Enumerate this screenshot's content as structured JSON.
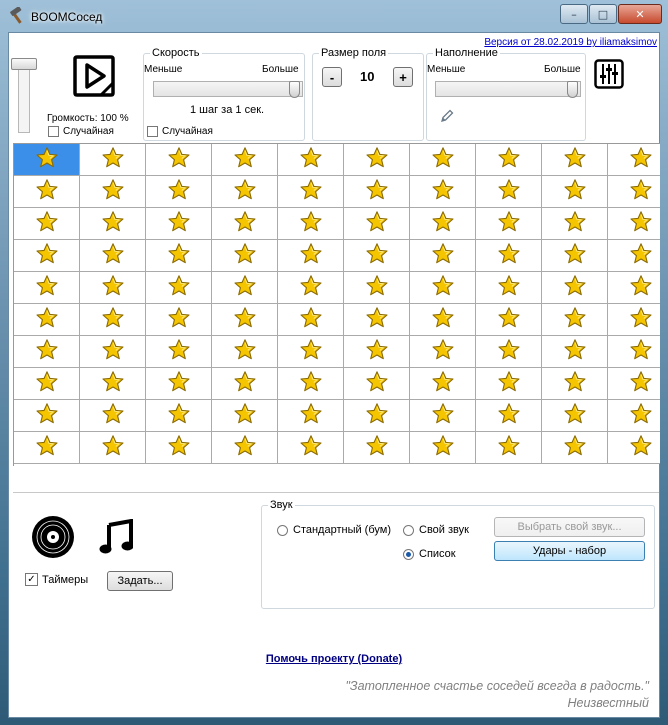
{
  "window": {
    "title": "BOOMСосед",
    "icon": "hammer-icon",
    "buttons": {
      "minimize": "–",
      "maximize": "□",
      "close": "✕"
    }
  },
  "version_link": "Версия от 28.02.2019 by iliamaksimov",
  "volume": {
    "label": "Громкость: 100 %",
    "value": 100,
    "random_label": "Случайная"
  },
  "speed": {
    "legend": "Скорость",
    "less": "Меньше",
    "more": "Больше",
    "step_text": "1 шаг за 1 сек.",
    "random_label": "Случайная"
  },
  "field_size": {
    "legend": "Размер поля",
    "minus": "-",
    "value": "10",
    "plus": "+"
  },
  "fill": {
    "legend": "Наполнение",
    "less": "Меньше",
    "more": "Больше",
    "edit_icon": "pencil-icon"
  },
  "mixer_icon": "equalizer-icon",
  "grid": {
    "rows": 10,
    "cols": 10,
    "cell_icon": "star-icon",
    "selected_cell": [
      0,
      0
    ],
    "selected_color": "#3b8fe8"
  },
  "bottom": {
    "vinyl_icon": "vinyl-record-icon",
    "music_icon": "music-note-icon",
    "timers_label": "Таймеры",
    "timers_checked": true,
    "set_button": "Задать..."
  },
  "sound": {
    "legend": "Звук",
    "standard_label": "Стандартный (бум)",
    "own_label": "Свой звук",
    "list_label": "Список",
    "selected": "list",
    "choose_button": "Выбрать свой звук...",
    "hits_button": "Удары - набор"
  },
  "donate_link": "Помочь проекту (Donate)",
  "quote": "\"Затопленное счастье соседей всегда в радость.\"",
  "author": "Неизвестный",
  "colors": {
    "link": "#0000cc",
    "donate": "#000080",
    "quote": "#808080",
    "star": "#f5c500"
  }
}
